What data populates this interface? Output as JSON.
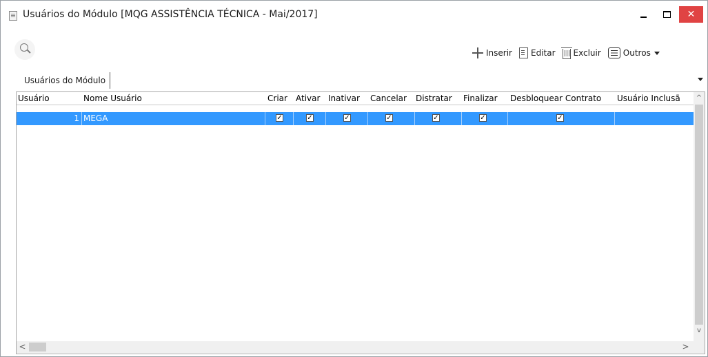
{
  "window": {
    "title": "Usuários do Módulo [MQG ASSISTÊNCIA TÉCNICA - Mai/2017]",
    "minimize_icon": "minimize-icon",
    "maximize_icon": "maximize-icon",
    "close_label": "✕"
  },
  "toolbar": {
    "search_icon": "search-icon",
    "insert_label": "Inserir",
    "edit_label": "Editar",
    "delete_label": "Excluir",
    "others_label": "Outros"
  },
  "tabs": [
    {
      "label": "Usuários do Módulo"
    }
  ],
  "grid": {
    "columns": [
      "Usuário",
      "Nome Usuário",
      "Criar",
      "Ativar",
      "Inativar",
      "Cancelar",
      "Distratar",
      "Finalizar",
      "Desbloquear Contrato",
      "Usuário Inclusã"
    ],
    "rows": [
      {
        "usuario": "1",
        "nome": "MEGA",
        "criar": true,
        "ativar": true,
        "inativar": true,
        "cancelar": true,
        "distratar": true,
        "finalizar": true,
        "desbloquear": true,
        "usuario_inclusao": ""
      }
    ],
    "selected_row_color": "#3399ff"
  },
  "scroll": {
    "up": "^",
    "down": "v",
    "left": "<",
    "right": ">"
  }
}
